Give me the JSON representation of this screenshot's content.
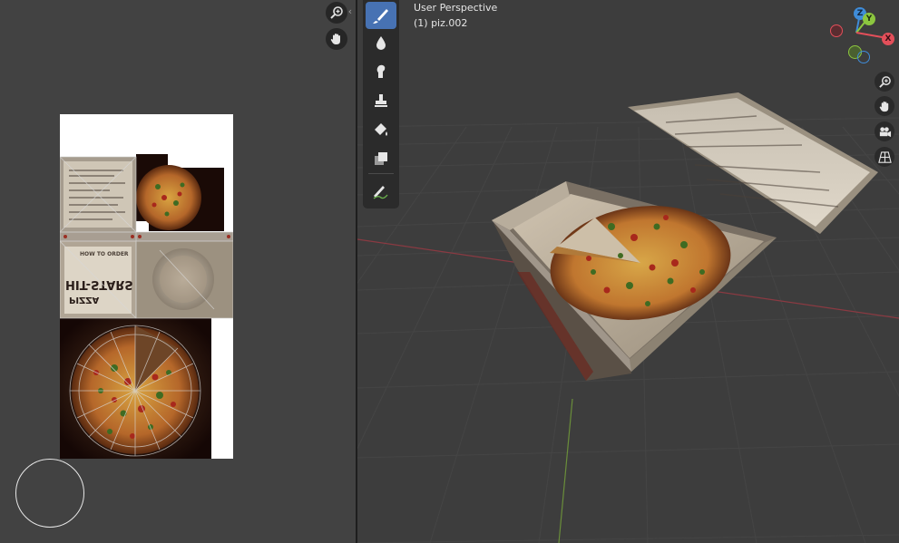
{
  "viewport": {
    "mode_label": "User Perspective",
    "object_label": "(1) piz.002"
  },
  "gizmo": {
    "z": "Z",
    "y": "Y",
    "x": "X"
  },
  "tools": [
    {
      "name": "draw-brush-icon",
      "active": true
    },
    {
      "name": "soften-icon",
      "active": false
    },
    {
      "name": "smear-icon",
      "active": false
    },
    {
      "name": "clone-stamp-icon",
      "active": false
    },
    {
      "name": "fill-icon",
      "active": false
    },
    {
      "name": "mask-icon",
      "active": false
    },
    {
      "name": "annotate-icon",
      "active": false
    }
  ],
  "texture_text": {
    "how_to_order": "HOW TO ORDER",
    "brand_line1": "PIZZA",
    "brand_line2": "HIT-STARS"
  },
  "colors": {
    "x_axis": "#e34f5a",
    "y_axis": "#8cc63f",
    "z_axis": "#3f8cd8",
    "active_tool": "#4772b3"
  }
}
